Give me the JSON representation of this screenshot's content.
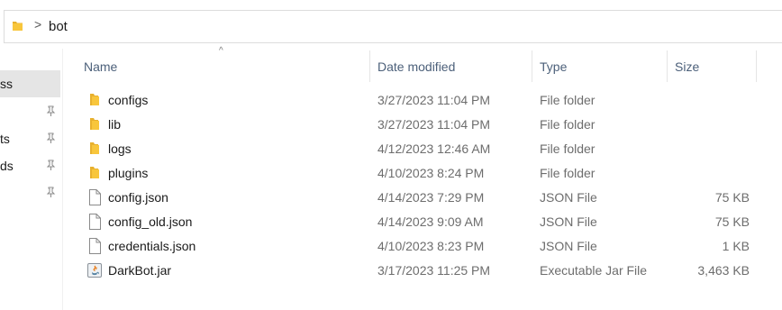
{
  "address_bar": {
    "breadcrumb": "bot",
    "separator": ">",
    "icon": "folder-icon"
  },
  "nav_pane": {
    "items": [
      {
        "label": "ss",
        "selected": true
      },
      {
        "label": "",
        "pinned": true
      },
      {
        "label": "ts",
        "pinned": true
      },
      {
        "label": "ds",
        "pinned": true
      },
      {
        "label": "",
        "pinned": true
      }
    ],
    "pin_icon": "pin-icon"
  },
  "columns": {
    "name": "Name",
    "date": "Date modified",
    "type": "Type",
    "size": "Size",
    "sort_indicator": "^"
  },
  "files": [
    {
      "name": "configs",
      "date": "3/27/2023 11:04 PM",
      "type": "File folder",
      "size": "",
      "icon": "folder-icon"
    },
    {
      "name": "lib",
      "date": "3/27/2023 11:04 PM",
      "type": "File folder",
      "size": "",
      "icon": "folder-icon"
    },
    {
      "name": "logs",
      "date": "4/12/2023 12:46 AM",
      "type": "File folder",
      "size": "",
      "icon": "folder-icon"
    },
    {
      "name": "plugins",
      "date": "4/10/2023 8:24 PM",
      "type": "File folder",
      "size": "",
      "icon": "folder-icon"
    },
    {
      "name": "config.json",
      "date": "4/14/2023 7:29 PM",
      "type": "JSON File",
      "size": "75 KB",
      "icon": "document-icon"
    },
    {
      "name": "config_old.json",
      "date": "4/14/2023 9:09 AM",
      "type": "JSON File",
      "size": "75 KB",
      "icon": "document-icon"
    },
    {
      "name": "credentials.json",
      "date": "4/10/2023 8:23 PM",
      "type": "JSON File",
      "size": "1 KB",
      "icon": "document-icon"
    },
    {
      "name": "DarkBot.jar",
      "date": "3/17/2023 11:25 PM",
      "type": "Executable Jar File",
      "size": "3,463 KB",
      "icon": "java-jar-icon"
    }
  ],
  "colors": {
    "folder": "#f8c63c",
    "header_text": "#4c607a",
    "selected_nav": "#e5e5e5",
    "secondary_text": "#6d6d6d"
  }
}
